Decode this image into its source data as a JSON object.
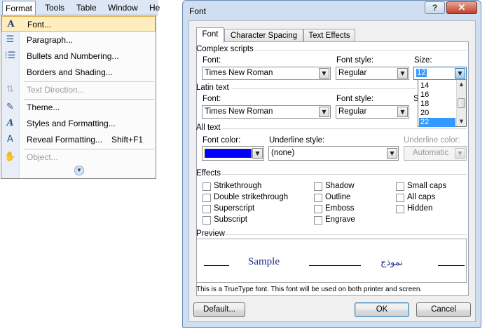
{
  "menubar": {
    "items": [
      "Format",
      "Tools",
      "Table",
      "Window",
      "He"
    ]
  },
  "format_menu": {
    "items": [
      {
        "label": "Font...",
        "icon": "font-a-icon",
        "shortcut": "",
        "enabled": true,
        "highlighted": true
      },
      {
        "label": "Paragraph...",
        "icon": "paragraph-icon",
        "shortcut": "",
        "enabled": true
      },
      {
        "label": "Bullets and Numbering...",
        "icon": "bullets-icon",
        "shortcut": "",
        "enabled": true
      },
      {
        "label": "Borders and Shading...",
        "icon": "",
        "shortcut": "",
        "enabled": true
      },
      {
        "label": "Text Direction...",
        "icon": "text-direction-icon",
        "shortcut": "",
        "enabled": false
      },
      {
        "label": "Theme...",
        "icon": "theme-icon",
        "shortcut": "",
        "enabled": true
      },
      {
        "label": "Styles and Formatting...",
        "icon": "styles-icon",
        "shortcut": "",
        "enabled": true
      },
      {
        "label": "Reveal Formatting...",
        "icon": "reveal-formatting-icon",
        "shortcut": "Shift+F1",
        "enabled": true
      },
      {
        "label": "Object...",
        "icon": "object-icon",
        "shortcut": "",
        "enabled": false
      }
    ]
  },
  "dialog": {
    "title": "Font",
    "help_label": "?",
    "close_label": "✕",
    "tabs": [
      "Font",
      "Character Spacing",
      "Text Effects"
    ],
    "complex_scripts": {
      "heading": "Complex scripts",
      "font_label": "Font:",
      "font_value": "Times New Roman",
      "style_label": "Font style:",
      "style_value": "Regular",
      "size_label": "Size:",
      "size_value": "12",
      "size_options": [
        "14",
        "16",
        "18",
        "20",
        "22"
      ],
      "size_selected": "22"
    },
    "latin_text": {
      "heading": "Latin text",
      "font_label": "Font:",
      "font_value": "Times New Roman",
      "style_label": "Font style:",
      "style_value": "Regular",
      "size_label": "S"
    },
    "all_text": {
      "heading": "All text",
      "font_color_label": "Font color:",
      "font_color": "#0000ff",
      "underline_style_label": "Underline style:",
      "underline_style_value": "(none)",
      "underline_color_label": "Underline color:",
      "underline_color_value": "Automatic"
    },
    "effects": {
      "heading": "Effects",
      "items": [
        "Strikethrough",
        "Double strikethrough",
        "Superscript",
        "Subscript",
        "Shadow",
        "Outline",
        "Emboss",
        "Engrave",
        "Small caps",
        "All caps",
        "Hidden"
      ]
    },
    "preview": {
      "heading": "Preview",
      "sample": "Sample",
      "arabic": "نموذج"
    },
    "note": "This is a TrueType font. This font will be used on both printer and screen.",
    "buttons": {
      "default": "Default...",
      "ok": "OK",
      "cancel": "Cancel"
    }
  },
  "colors": {
    "menu_highlight": "#ffeebd",
    "dialog_frame": "#cfdff1",
    "list_selection": "#3399ff",
    "preview_text": "#1b2a8f"
  }
}
